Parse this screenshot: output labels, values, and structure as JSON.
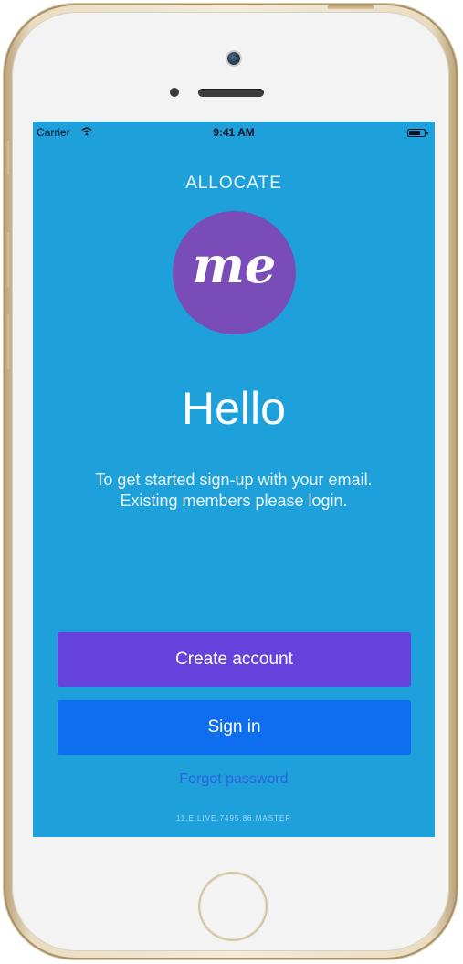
{
  "status_bar": {
    "carrier": "Carrier",
    "time": "9:41 AM",
    "wifi_icon": "wifi-icon",
    "battery_icon": "battery-icon"
  },
  "brand": "ALLOCATE",
  "logo": {
    "text": "me",
    "color": "#7a4cb8"
  },
  "hello": "Hello",
  "intro": {
    "line1": "To get started sign-up with your email.",
    "line2": "Existing members please login."
  },
  "buttons": {
    "create_account": "Create account",
    "sign_in": "Sign in"
  },
  "forgot_password": "Forgot password",
  "version": "11.E.LIVE.7495.86.MASTER",
  "colors": {
    "screen_background": "#1ea0db",
    "create_account": "#6442db",
    "sign_in": "#0f6ef0",
    "forgot_link": "#2f60df"
  }
}
